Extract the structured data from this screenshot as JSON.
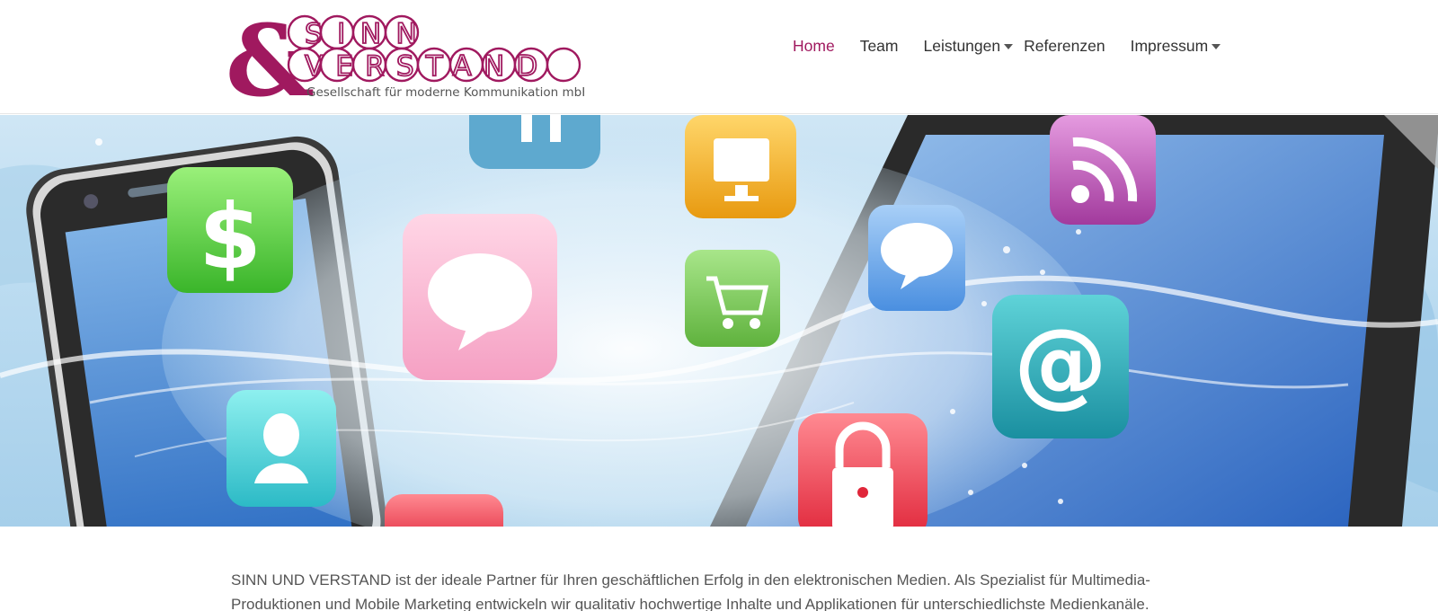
{
  "logo": {
    "line1": "SINN",
    "line2": "VERSTAND",
    "tagline": "Gesellschaft für moderne Kommunikation mbH",
    "ampersand": "&",
    "brand_color": "#a0195f"
  },
  "nav": {
    "items": [
      {
        "label": "Home",
        "active": true,
        "dropdown": false
      },
      {
        "label": "Team",
        "active": false,
        "dropdown": false
      },
      {
        "label": "Leistungen",
        "active": false,
        "dropdown": true
      },
      {
        "label": "Referenzen",
        "active": false,
        "dropdown": false
      },
      {
        "label": "Impressum",
        "active": false,
        "dropdown": true
      }
    ],
    "active_color": "#a0195f",
    "text_color": "#333333"
  },
  "hero": {
    "icons": [
      "dollar-icon",
      "chat-bubble-icon",
      "monitor-icon",
      "shopping-cart-icon",
      "speech-bubble-icon",
      "rss-icon",
      "at-sign-icon",
      "user-icon",
      "lock-icon"
    ]
  },
  "intro": {
    "text": "SINN UND VERSTAND ist der ideale Partner für Ihren geschäftlichen Erfolg in den elektronischen Medien. Als Spezialist für Multimedia-Produktionen und Mobile Marketing entwickeln wir qualitativ hochwertige Inhalte und Applikationen für unterschiedlichste Medienkanäle."
  }
}
